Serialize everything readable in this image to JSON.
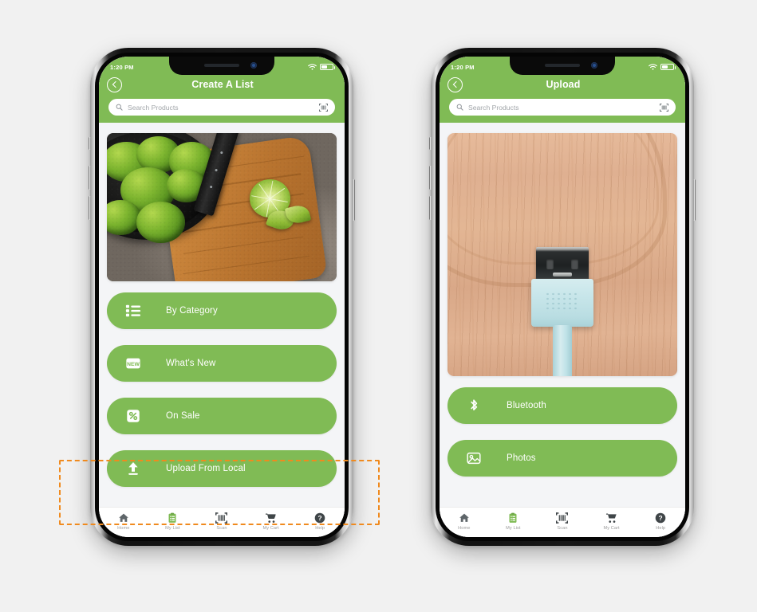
{
  "page": {
    "background_color": "#f1f1f1",
    "brand_green": "#80bb55",
    "annotation_color": "#f08a1e"
  },
  "phones": [
    {
      "id": "left-phone",
      "status_bar": {
        "time": "1:20 PM",
        "wifi_icon": "wifi-icon",
        "battery_icon": "battery-icon"
      },
      "header": {
        "back_icon": "back-chevron-icon",
        "title": "Create A List"
      },
      "search": {
        "icon": "search-icon",
        "placeholder": "Search Products",
        "value": "",
        "trailing_icon": "barcode-scan-icon"
      },
      "hero_image": {
        "name": "limes-in-pan-photo",
        "alt": "Green limes in a black cast-iron pan with an orange cloth and knife on a stone counter"
      },
      "actions": [
        {
          "icon": "list-bullets-icon",
          "label": "By Category"
        },
        {
          "icon": "new-badge-icon",
          "label": "What's New"
        },
        {
          "icon": "percent-tag-icon",
          "label": "On Sale"
        },
        {
          "icon": "upload-arrow-icon",
          "label": "Upload From Local"
        }
      ],
      "tabbar": [
        {
          "icon": "home-icon",
          "label": "Home",
          "active": false
        },
        {
          "icon": "clipboard-list-icon",
          "label": "My List",
          "active": true
        },
        {
          "icon": "barcode-scan-icon",
          "label": "Scan",
          "active": false
        },
        {
          "icon": "shopping-cart-icon",
          "label": "My Cart",
          "active": false
        },
        {
          "icon": "question-help-icon",
          "label": "Help",
          "active": false
        }
      ]
    },
    {
      "id": "right-phone",
      "status_bar": {
        "time": "1:20 PM",
        "wifi_icon": "wifi-icon",
        "battery_icon": "battery-icon"
      },
      "header": {
        "back_icon": "back-chevron-icon",
        "title": "Upload"
      },
      "search": {
        "icon": "search-icon",
        "placeholder": "Search Products",
        "value": "",
        "trailing_icon": "barcode-scan-icon"
      },
      "hero_image": {
        "name": "usb-cable-photo",
        "alt": "Light blue USB type-A cable connector lying on a wooden surface"
      },
      "actions": [
        {
          "icon": "bluetooth-icon",
          "label": "Bluetooth"
        },
        {
          "icon": "photo-image-icon",
          "label": "Photos"
        }
      ],
      "tabbar": [
        {
          "icon": "home-icon",
          "label": "Home",
          "active": false
        },
        {
          "icon": "clipboard-list-icon",
          "label": "My List",
          "active": true
        },
        {
          "icon": "barcode-scan-icon",
          "label": "Scan",
          "active": false
        },
        {
          "icon": "shopping-cart-icon",
          "label": "My Cart",
          "active": false
        },
        {
          "icon": "question-help-icon",
          "label": "Help",
          "active": false
        }
      ]
    }
  ],
  "annotation": {
    "name": "upload-from-local-highlight",
    "style": "dashed-rectangle"
  }
}
